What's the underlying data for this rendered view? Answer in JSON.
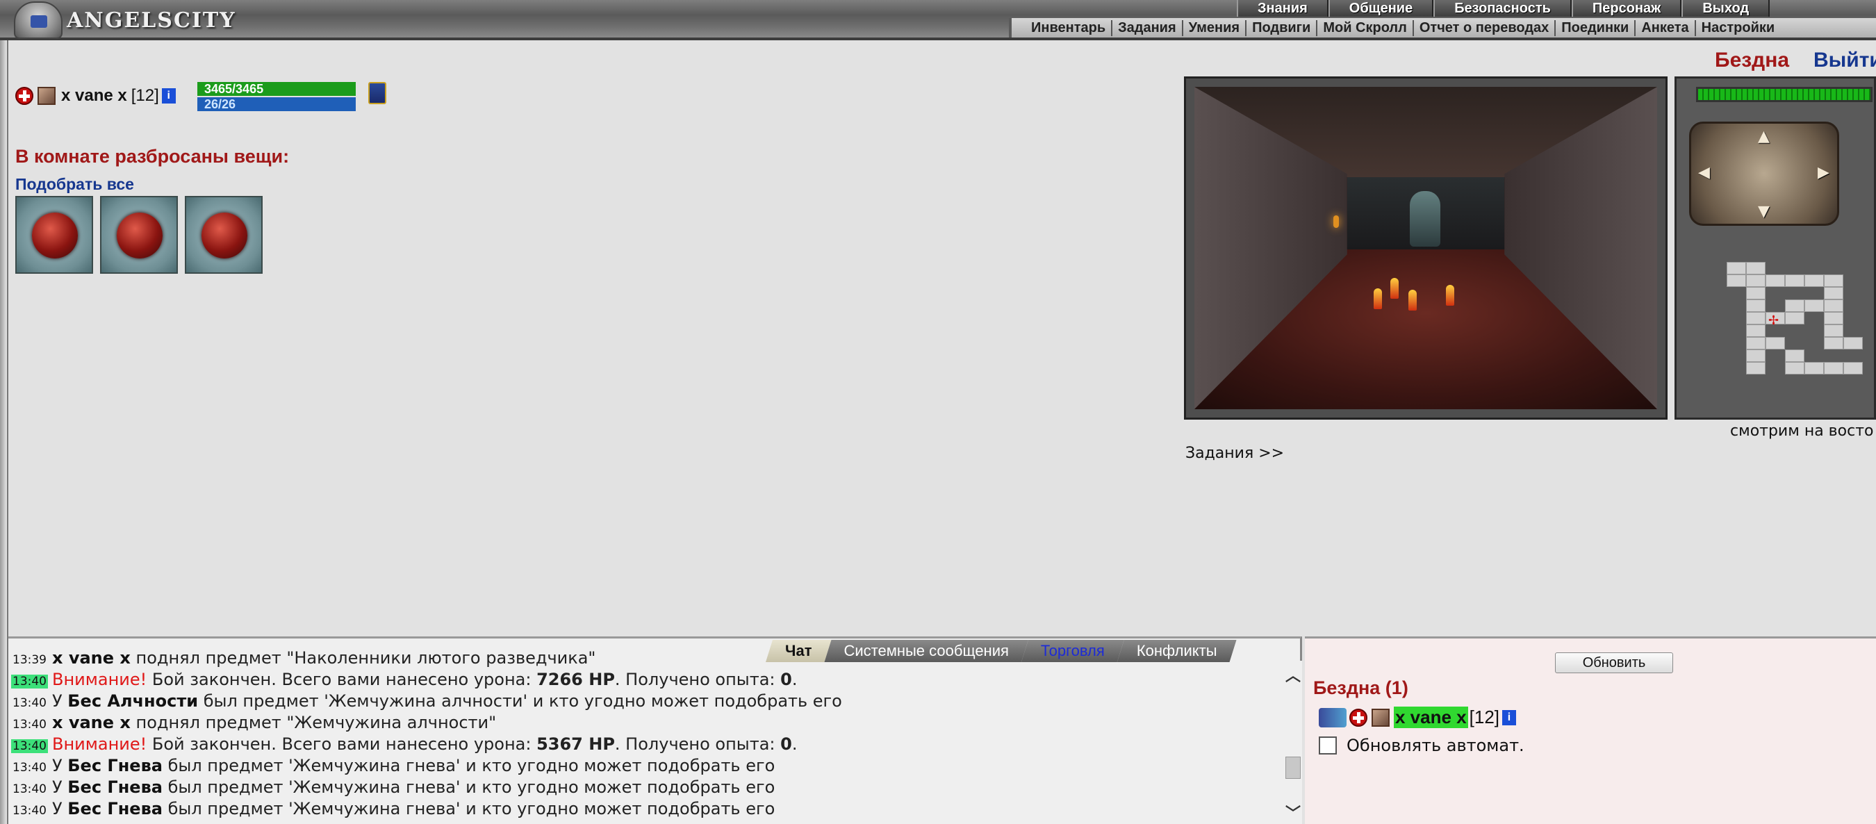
{
  "header": {
    "logo_text": "ANGELSCITY",
    "top_menu": [
      "Знания",
      "Общение",
      "Безопасность",
      "Персонаж",
      "Выход"
    ],
    "sub_menu": [
      "Инвентарь",
      "Задания",
      "Умения",
      "Подвиги",
      "Мой Скролл",
      "Отчет о переводах",
      "Поединки",
      "Анкета",
      "Настройки"
    ]
  },
  "location": {
    "title": "Бездна",
    "exit_label": "Выйти"
  },
  "player": {
    "name": "x vane x",
    "level": "[12]",
    "hp": "3465/3465",
    "mana": "26/26",
    "info_glyph": "i"
  },
  "items": {
    "heading": "В комнате разбросаны вещи:",
    "pick_all": "Подобрать все",
    "list": [
      {
        "icon": "red-pearl-icon"
      },
      {
        "icon": "red-pearl-icon"
      },
      {
        "icon": "red-pearl-icon"
      }
    ]
  },
  "view": {
    "direction_label": "смотрим на восто",
    "quests_link": "Задания >>"
  },
  "minimap": {
    "arrows": {
      "up": "▲",
      "down": "▼",
      "left": "◀",
      "right": "▶"
    },
    "marker": "✢"
  },
  "chat": {
    "tabs": [
      "Чат",
      "Системные сообщения",
      "Торговля",
      "Конфликты"
    ],
    "scroll": {
      "up": "︿",
      "down": "﹀"
    },
    "lines": [
      {
        "time": "13:39",
        "hl": false,
        "parts": [
          {
            "cls": "nick",
            "t": "x vane x"
          },
          {
            "cls": "",
            "t": " поднял предмет \"Наколенники лютого разведчика\""
          }
        ]
      },
      {
        "time": "13:40",
        "hl": true,
        "parts": [
          {
            "cls": "warn",
            "t": "Внимание!"
          },
          {
            "cls": "",
            "t": " Бой закончен. Всего вами нанесено урона: "
          },
          {
            "cls": "b",
            "t": "7266 HP"
          },
          {
            "cls": "",
            "t": ". Получено опыта: "
          },
          {
            "cls": "b",
            "t": "0"
          },
          {
            "cls": "",
            "t": "."
          }
        ]
      },
      {
        "time": "13:40",
        "hl": false,
        "parts": [
          {
            "cls": "",
            "t": "У "
          },
          {
            "cls": "nick",
            "t": "Бес Алчности"
          },
          {
            "cls": "",
            "t": " был предмет 'Жемчужина алчности' и кто угодно может подобрать его"
          }
        ]
      },
      {
        "time": "13:40",
        "hl": false,
        "parts": [
          {
            "cls": "nick",
            "t": "x vane x"
          },
          {
            "cls": "",
            "t": " поднял предмет \"Жемчужина алчности\""
          }
        ]
      },
      {
        "time": "13:40",
        "hl": true,
        "parts": [
          {
            "cls": "warn",
            "t": "Внимание!"
          },
          {
            "cls": "",
            "t": " Бой закончен. Всего вами нанесено урона: "
          },
          {
            "cls": "b",
            "t": "5367 HP"
          },
          {
            "cls": "",
            "t": ". Получено опыта: "
          },
          {
            "cls": "b",
            "t": "0"
          },
          {
            "cls": "",
            "t": "."
          }
        ]
      },
      {
        "time": "13:40",
        "hl": false,
        "parts": [
          {
            "cls": "",
            "t": "У "
          },
          {
            "cls": "nick",
            "t": "Бес Гнева"
          },
          {
            "cls": "",
            "t": " был предмет 'Жемчужина гнева' и кто угодно может подобрать его"
          }
        ]
      },
      {
        "time": "13:40",
        "hl": false,
        "parts": [
          {
            "cls": "",
            "t": "У "
          },
          {
            "cls": "nick",
            "t": "Бес Гнева"
          },
          {
            "cls": "",
            "t": " был предмет 'Жемчужина гнева' и кто угодно может подобрать его"
          }
        ]
      },
      {
        "time": "13:40",
        "hl": false,
        "parts": [
          {
            "cls": "",
            "t": "У "
          },
          {
            "cls": "nick",
            "t": "Бес Гнева"
          },
          {
            "cls": "",
            "t": " был предмет 'Жемчужина гнева' и кто угодно может подобрать его"
          }
        ]
      }
    ]
  },
  "who": {
    "refresh_label": "Обновить",
    "title": "Бездна (1)",
    "player_name": "x vane x",
    "player_level": "[12]",
    "auto_refresh_label": "Обновлять автомат."
  }
}
